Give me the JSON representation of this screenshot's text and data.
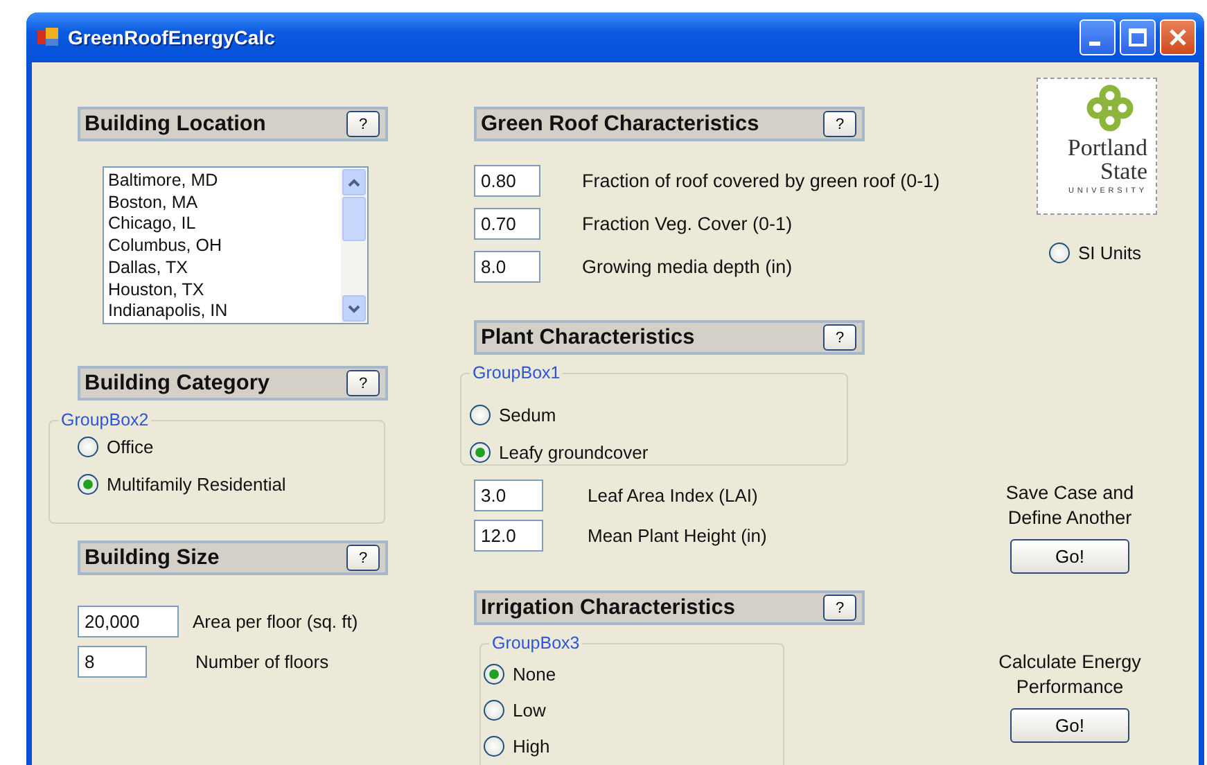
{
  "window": {
    "title": "GreenRoofEnergyCalc"
  },
  "building_location": {
    "heading": "Building Location",
    "help": "?",
    "cities": [
      "Baltimore, MD",
      "Boston, MA",
      "Chicago, IL",
      "Columbus, OH",
      "Dallas, TX",
      "Houston, TX",
      "Indianapolis, IN"
    ]
  },
  "building_category": {
    "heading": "Building Category",
    "help": "?",
    "group": "GroupBox2",
    "options": [
      {
        "label": "Office",
        "selected": false
      },
      {
        "label": "Multifamily Residential",
        "selected": true
      }
    ]
  },
  "building_size": {
    "heading": "Building Size",
    "help": "?",
    "fields": [
      {
        "value": "20,000",
        "label": "Area per floor (sq. ft)"
      },
      {
        "value": "8",
        "label": "Number of floors"
      }
    ]
  },
  "green_roof": {
    "heading": "Green Roof Characteristics",
    "help": "?",
    "fields": [
      {
        "value": "0.80",
        "label": "Fraction of roof covered by green roof (0-1)"
      },
      {
        "value": "0.70",
        "label": "Fraction Veg. Cover (0-1)"
      },
      {
        "value": "8.0",
        "label": "Growing media depth (in)"
      }
    ]
  },
  "plant": {
    "heading": "Plant Characteristics",
    "help": "?",
    "group": "GroupBox1",
    "options": [
      {
        "label": "Sedum",
        "selected": false
      },
      {
        "label": "Leafy groundcover",
        "selected": true
      }
    ],
    "fields": [
      {
        "value": "3.0",
        "label": "Leaf Area Index (LAI)"
      },
      {
        "value": "12.0",
        "label": "Mean Plant Height (in)"
      }
    ]
  },
  "irrigation": {
    "heading": "Irrigation Characteristics",
    "help": "?",
    "group": "GroupBox3",
    "options": [
      {
        "label": "None",
        "selected": true
      },
      {
        "label": "Low",
        "selected": false
      },
      {
        "label": "High",
        "selected": false
      }
    ]
  },
  "logo": {
    "lines": [
      "Portland",
      "State",
      "UNIVERSITY"
    ]
  },
  "si_units": {
    "label": "SI Units",
    "selected": false
  },
  "actions": [
    {
      "caption_lines": [
        "Save Case and",
        "Define Another"
      ],
      "button": "Go!"
    },
    {
      "caption_lines": [
        "Calculate Energy",
        "Performance"
      ],
      "button": "Go!"
    }
  ]
}
